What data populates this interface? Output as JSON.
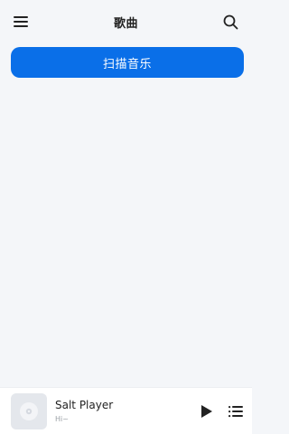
{
  "header": {
    "title": "歌曲",
    "menu_icon": "menu-icon",
    "search_icon": "search-icon"
  },
  "main": {
    "scan_button_label": "扫描音乐"
  },
  "player": {
    "title": "Salt Player",
    "subtitle": "Hi~",
    "cover_icon": "disc-icon",
    "play_icon": "play-icon",
    "queue_icon": "playlist-icon"
  },
  "colors": {
    "accent": "#0a6fe8",
    "background": "#f4f6f9"
  }
}
